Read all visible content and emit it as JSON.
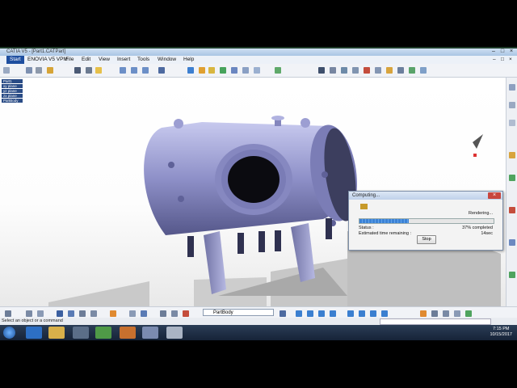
{
  "window": {
    "title": "CATIA V5 - [Part1.CATPart]"
  },
  "menu": {
    "items": [
      "Start",
      "ENOVIA V5 VPM",
      "File",
      "Edit",
      "View",
      "Insert",
      "Tools",
      "Window",
      "Help"
    ]
  },
  "tree": {
    "items": [
      "Part1",
      "xy plane",
      "yz plane",
      "zx plane",
      "PartBody"
    ]
  },
  "bottom_toolbar": {
    "current_body": "PartBody"
  },
  "status_bar": {
    "text": "Select an object or a command"
  },
  "dialog": {
    "title": "Computing...",
    "state": "Rendering...",
    "progress_percent": 37,
    "status_label": "Status :",
    "status_value": "37% completed",
    "time_label": "Estimated time remaining :",
    "time_value": "14sec",
    "stop_label": "Stop"
  },
  "taskbar": {
    "time": "7:15 PM",
    "date": "10/15/2017"
  }
}
